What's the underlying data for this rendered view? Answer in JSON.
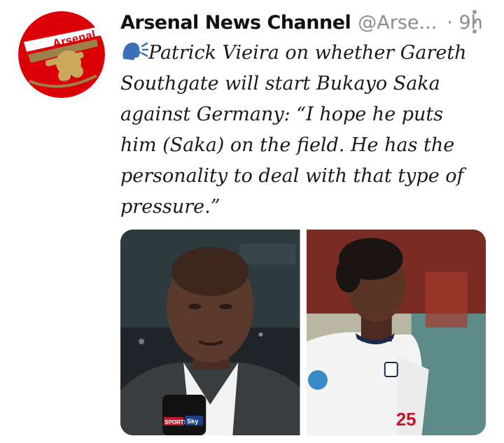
{
  "tweet": {
    "author_name": "Arsenal News Channel",
    "handle": "@Arse...",
    "time": "· 9h",
    "text": "Patrick Vieira on whether Gareth Southgate will start Bukayo Saka against Germany: “I hope he puts him (Saka) on the field. He has the personality to deal with that type of pressure.”",
    "avatar_crest_text": "Arsenal",
    "emoji": "speaking-head-icon"
  },
  "media": {
    "left_photo_mic_text": "SPORTS",
    "left_photo_mic_brand": "Sky",
    "right_photo_shirt_number": "25"
  },
  "colors": {
    "arsenal_red": "#db0007",
    "arsenal_gold": "#9c824a",
    "text_gray": "#8c8c8c"
  }
}
